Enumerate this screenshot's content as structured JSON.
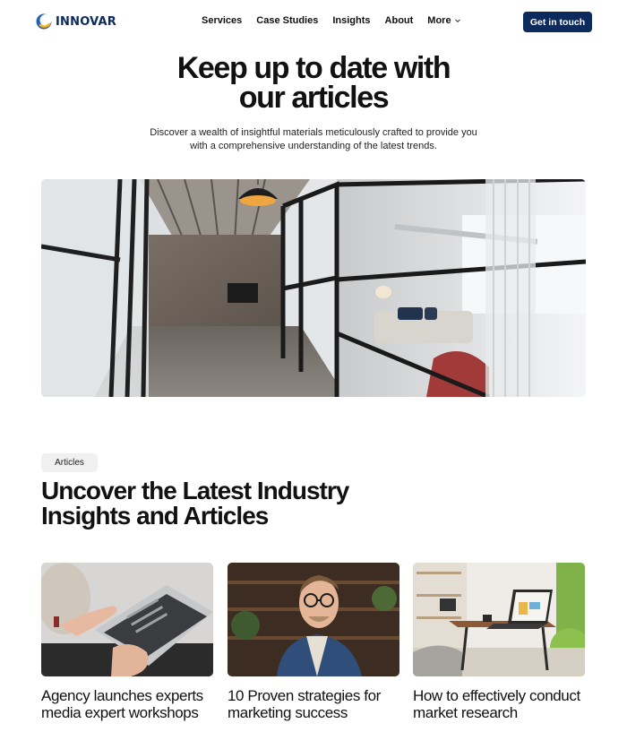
{
  "brand": {
    "name": "INNOVAR",
    "color": "#0c2a5b",
    "logo_icon": "crescent-logo-icon"
  },
  "nav": {
    "items": [
      {
        "label": "Services"
      },
      {
        "label": "Case Studies"
      },
      {
        "label": "Insights"
      },
      {
        "label": "About"
      },
      {
        "label": "More",
        "icon": "chevron-down-icon"
      }
    ],
    "cta_label": "Get in touch"
  },
  "hero": {
    "title_line1": "Keep up to date with",
    "title_line2": "our articles",
    "subtitle": "Discover a wealth of insightful materials meticulously crafted to provide you with a comprehensive understanding of the latest trends."
  },
  "articles": {
    "pill_label": "Articles",
    "title_line1": "Uncover the Latest Industry",
    "title_line2": "Insights and Articles",
    "cards": [
      {
        "title": "Agency launches experts media expert workshops"
      },
      {
        "title": "10 Proven strategies for marketing success"
      },
      {
        "title": "How to effectively conduct market research"
      }
    ]
  }
}
